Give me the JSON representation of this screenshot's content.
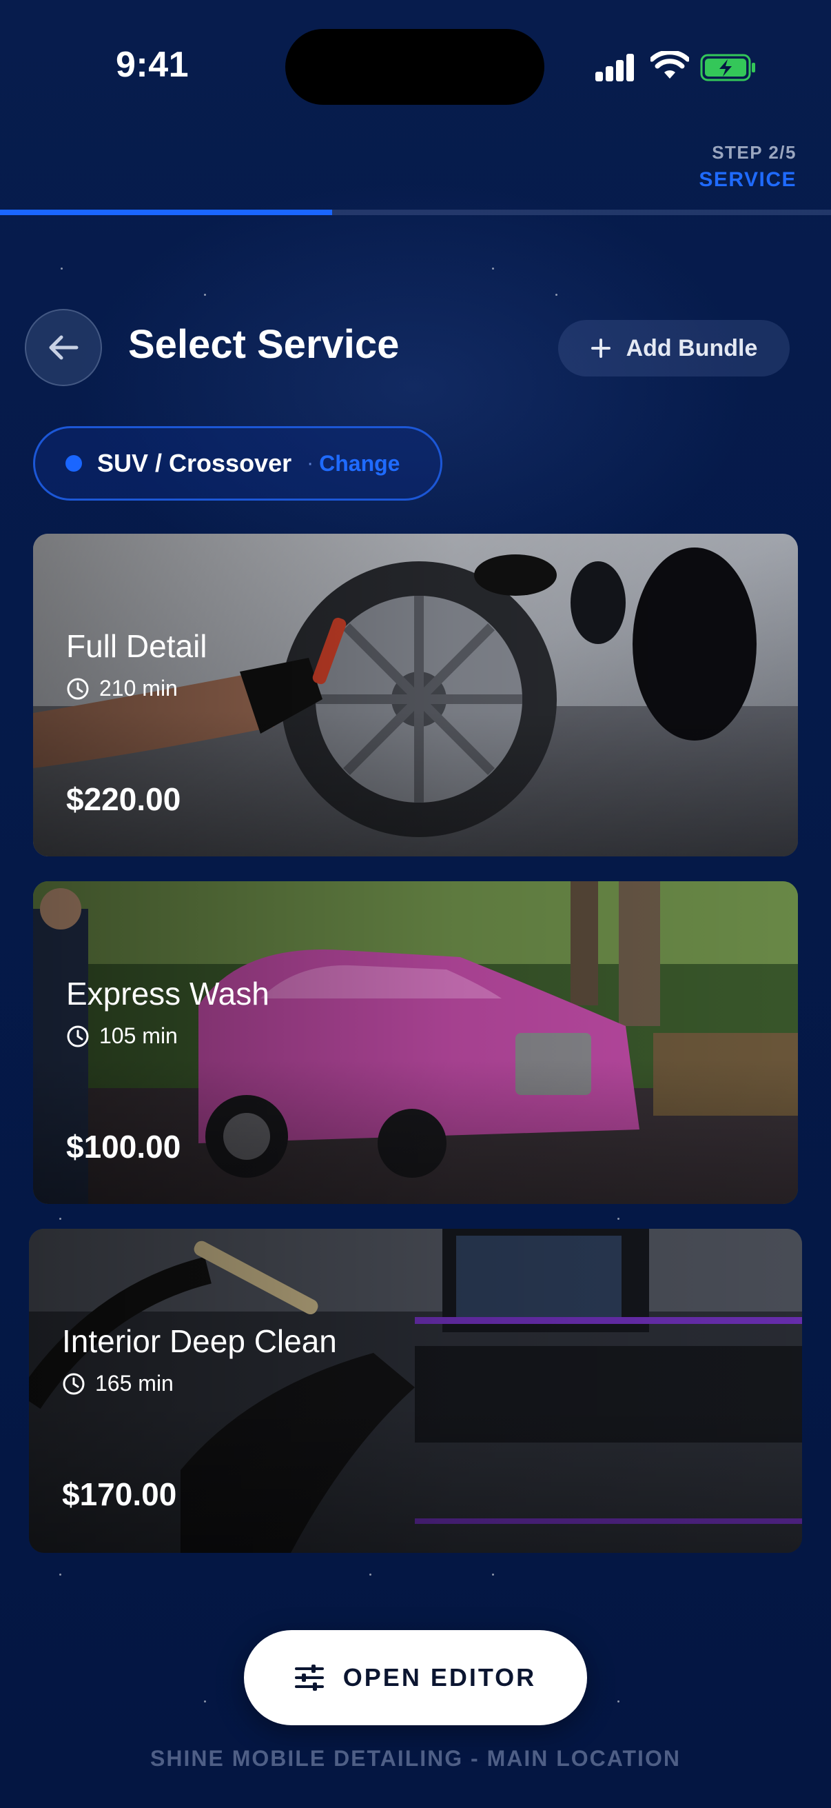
{
  "status_bar": {
    "time": "9:41"
  },
  "step": {
    "counter": "STEP 2/5",
    "name": "SERVICE",
    "progress": 0.4
  },
  "header": {
    "title": "Select Service",
    "add_bundle_label": "Add Bundle"
  },
  "vehicle": {
    "type": "SUV / Crossover",
    "change_label": "Change",
    "separator": "·"
  },
  "services": [
    {
      "name": "Full Detail",
      "duration": "210 min",
      "price": "$220.00"
    },
    {
      "name": "Express Wash",
      "duration": "105 min",
      "price": "$100.00"
    },
    {
      "name": "Interior Deep Clean",
      "duration": "165 min",
      "price": "$170.00"
    }
  ],
  "actions": {
    "open_editor_label": "OPEN EDITOR"
  },
  "footer": {
    "location": "SHINE MOBILE DETAILING - MAIN LOCATION"
  },
  "colors": {
    "accent": "#1a66ff",
    "background": "#041642",
    "battery": "#34c759"
  },
  "icons": [
    "signal-icon",
    "wifi-icon",
    "battery-icon",
    "back-arrow-icon",
    "plus-icon",
    "clock-icon",
    "sliders-icon"
  ]
}
